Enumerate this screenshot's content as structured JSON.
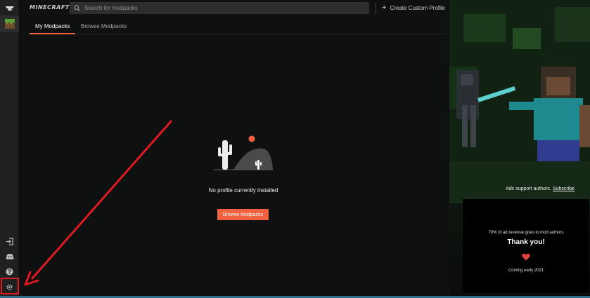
{
  "sidebar": {
    "items": [
      {
        "name": "logo",
        "icon": "curseforge-anvil-icon"
      },
      {
        "name": "game-minecraft",
        "icon": "grass-block-icon"
      },
      {
        "name": "login",
        "icon": "login-icon"
      },
      {
        "name": "discord",
        "icon": "discord-icon"
      },
      {
        "name": "help",
        "icon": "help-icon"
      },
      {
        "name": "settings",
        "icon": "gear-icon"
      }
    ]
  },
  "topbar": {
    "brand": "MINECRAFT",
    "search_placeholder": "Search for modpacks",
    "create_label": "Create Custom Profile"
  },
  "tabs": [
    {
      "label": "My Modpacks",
      "active": true
    },
    {
      "label": "Browse Modpacks",
      "active": false
    }
  ],
  "empty_state": {
    "message": "No profile currently installed",
    "button_label": "Browse Modpacks"
  },
  "ad": {
    "support_text": "Ads support authors.",
    "subscribe_label": "Subscribe",
    "revenue_text": "70% of ad revenue goes to mod authors",
    "thanks": "Thank you!",
    "coming": "Coming early 2021"
  },
  "colors": {
    "accent": "#f2613f",
    "annotation": "#e01a22",
    "sidebar": "#1f2020",
    "background": "#0f1010"
  }
}
